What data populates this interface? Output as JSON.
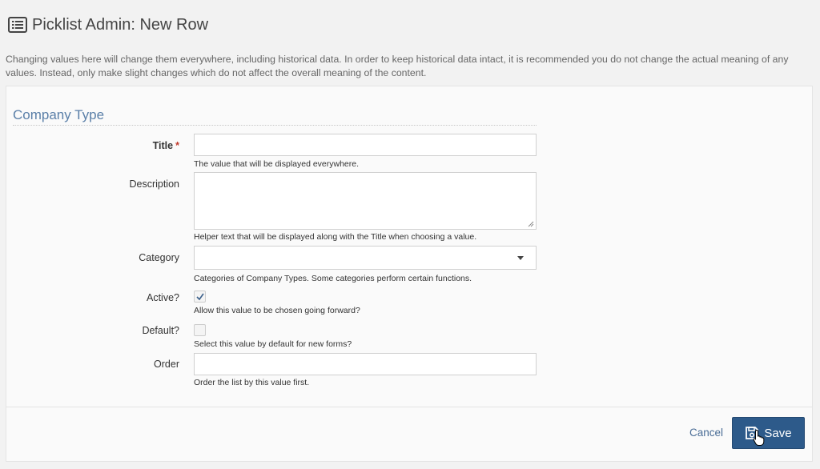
{
  "header": {
    "title": "Picklist Admin: New Row",
    "icon": "list-alt-icon"
  },
  "notice": "Changing values here will change them everywhere, including historical data. In order to keep historical data intact, it is recommended you do not change the actual meaning of any values. Instead, only make slight changes which do not affect the overall meaning of the content.",
  "form": {
    "section_title": "Company Type",
    "title_field": {
      "label": "Title",
      "required_marker": "*",
      "value": "",
      "help": "The value that will be displayed everywhere."
    },
    "description_field": {
      "label": "Description",
      "value": "",
      "help": "Helper text that will be displayed along with the Title when choosing a value."
    },
    "category_field": {
      "label": "Category",
      "selected": "",
      "help": "Categories of Company Types. Some categories perform certain functions."
    },
    "active_field": {
      "label": "Active?",
      "checked": true,
      "help": "Allow this value to be chosen going forward?"
    },
    "default_field": {
      "label": "Default?",
      "checked": false,
      "help": "Select this value by default for new forms?"
    },
    "order_field": {
      "label": "Order",
      "value": "",
      "help": "Order the list by this value first."
    }
  },
  "footer": {
    "cancel_label": "Cancel",
    "save_label": "Save"
  },
  "colors": {
    "accent": "#2d5a8a",
    "link": "#4a6d96",
    "section_title": "#5a7fa8",
    "required": "#c0392b"
  }
}
